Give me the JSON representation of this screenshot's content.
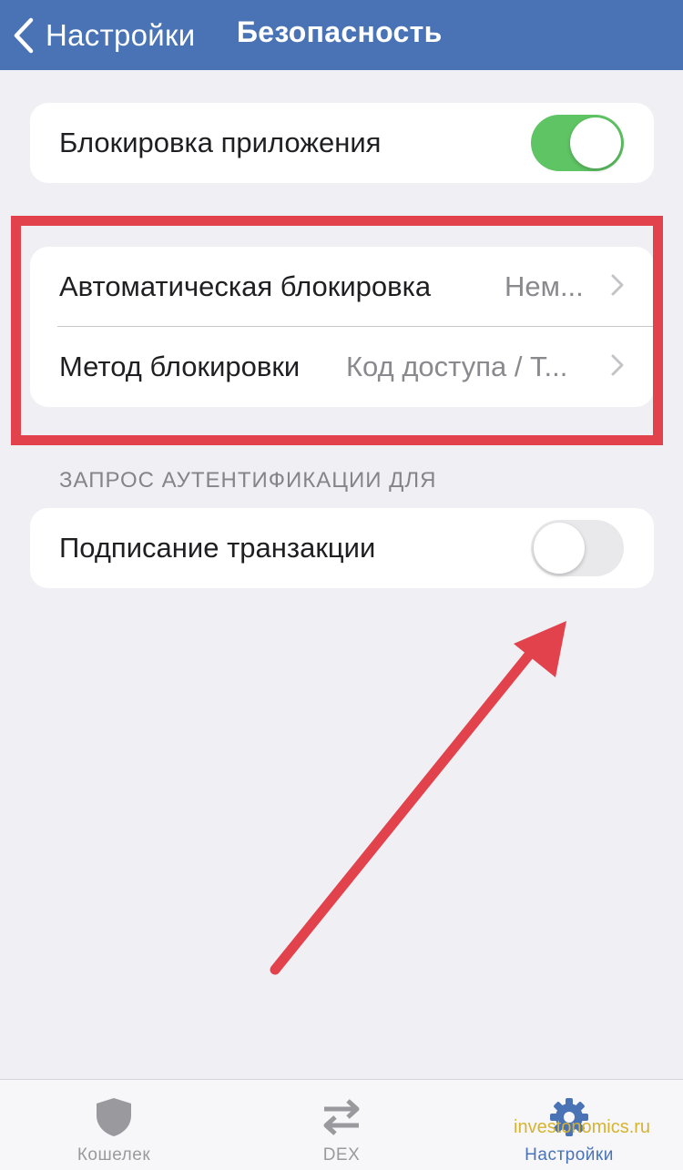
{
  "navbar": {
    "back_label": "Настройки",
    "title": "Безопасность"
  },
  "app_lock": {
    "label": "Блокировка приложения",
    "enabled": true
  },
  "lock_settings": {
    "auto_lock": {
      "label": "Автоматическая блокировка",
      "value": "Нем..."
    },
    "lock_method": {
      "label": "Метод блокировки",
      "value": "Код доступа / Т..."
    }
  },
  "auth_section": {
    "header": "ЗАПРОС АУТЕНТИФИКАЦИИ ДЛЯ",
    "transaction_signing": {
      "label": "Подписание транзакции",
      "enabled": false
    }
  },
  "tabbar": {
    "tabs": [
      {
        "label": "Кошелек",
        "icon": "shield-icon",
        "active": false
      },
      {
        "label": "DEX",
        "icon": "swap-arrows-icon",
        "active": false
      },
      {
        "label": "Настройки",
        "icon": "gear-icon",
        "active": true
      }
    ]
  },
  "watermark": "investonomics.ru",
  "colors": {
    "navbar": "#4a73b6",
    "toggle_on": "#5fc464",
    "annotation_red": "#e2424b",
    "background": "#efeff4"
  }
}
